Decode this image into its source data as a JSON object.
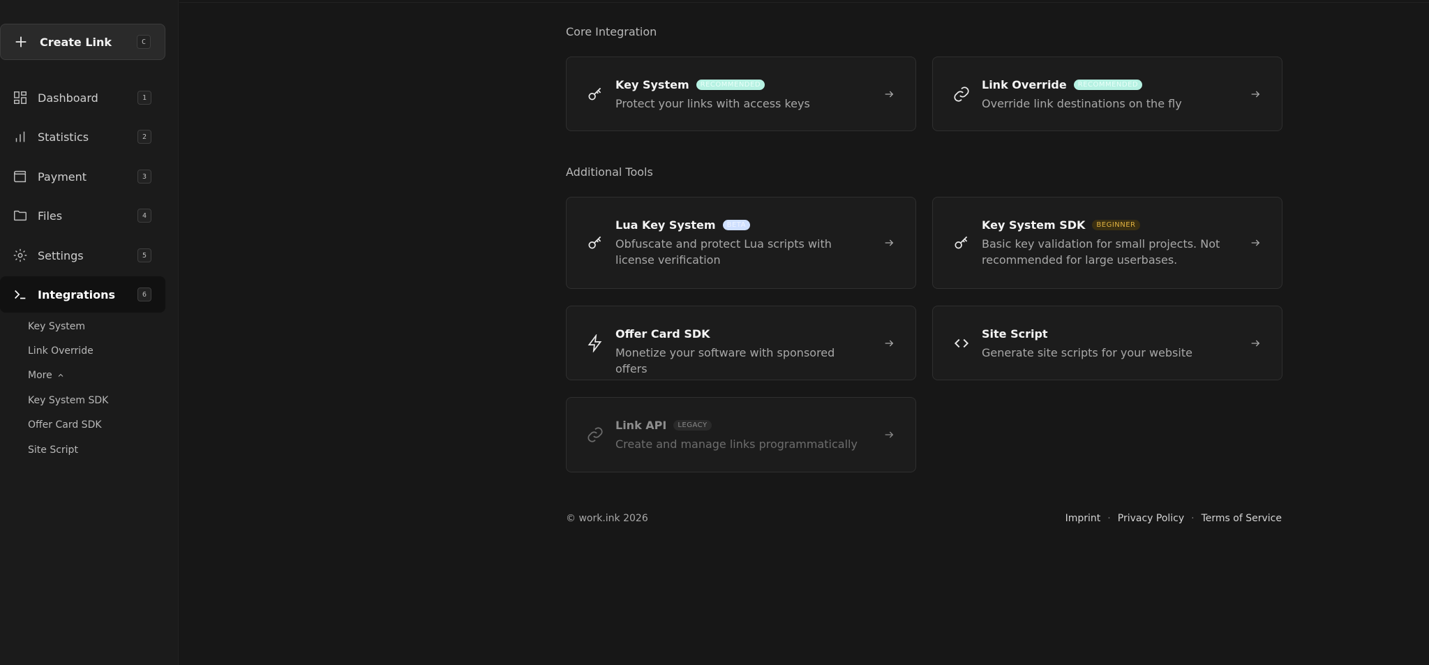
{
  "sidebar": {
    "create_button": {
      "label": "Create Link",
      "shortcut": "C"
    },
    "items": [
      {
        "label": "Dashboard",
        "shortcut": "1",
        "icon": "grid-icon"
      },
      {
        "label": "Statistics",
        "shortcut": "2",
        "icon": "bar-chart-icon"
      },
      {
        "label": "Payment",
        "shortcut": "3",
        "icon": "wallet-icon"
      },
      {
        "label": "Files",
        "shortcut": "4",
        "icon": "folder-icon"
      },
      {
        "label": "Settings",
        "shortcut": "5",
        "icon": "gear-icon"
      },
      {
        "label": "Integrations",
        "shortcut": "6",
        "icon": "terminal-icon",
        "active": true
      }
    ],
    "sub_items": [
      "Key System",
      "Link Override",
      "More",
      "Key System SDK",
      "Offer Card SDK",
      "Site Script"
    ]
  },
  "main": {
    "core_title": "Core Integration",
    "additional_title": "Additional Tools",
    "core_cards": [
      {
        "title": "Key System",
        "badge": "RECOMMENDED",
        "desc": "Protect your links with access keys",
        "icon": "key-icon"
      },
      {
        "title": "Link Override",
        "badge": "RECOMMENDED",
        "desc": "Override link destinations on the fly",
        "icon": "link-icon"
      }
    ],
    "tool_cards": [
      {
        "title": "Lua Key System",
        "badge": "BETA",
        "desc": "Obfuscate and protect Lua scripts with license verification",
        "icon": "key-icon"
      },
      {
        "title": "Key System SDK",
        "badge": "BEGINNER",
        "desc": "Basic key validation for small projects. Not recommended for large userbases.",
        "icon": "key-icon"
      },
      {
        "title": "Offer Card SDK",
        "badge": "",
        "desc": "Monetize your software with sponsored offers",
        "icon": "lightning-icon"
      },
      {
        "title": "Site Script",
        "badge": "",
        "desc": "Generate site scripts for your website",
        "icon": "code-icon"
      },
      {
        "title": "Link API",
        "badge": "LEGACY",
        "desc": "Create and manage links programmatically",
        "icon": "link-icon"
      }
    ]
  },
  "footer": {
    "copyright": "© work.ink 2026",
    "links": [
      "Imprint",
      "Privacy Policy",
      "Terms of Service"
    ]
  }
}
